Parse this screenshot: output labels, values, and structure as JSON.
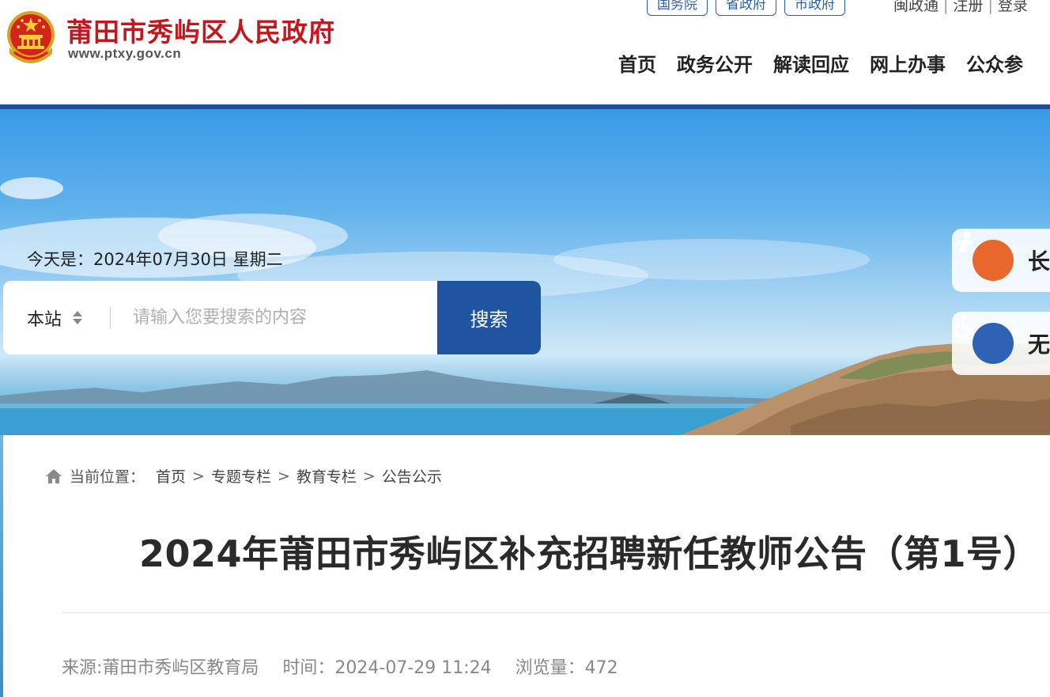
{
  "header": {
    "site_title": "莆田市秀屿区人民政府",
    "site_domain": "www.ptxy.gov.cn",
    "external_links": [
      "国务院",
      "省政府",
      "市政府"
    ],
    "user_links": [
      "闽政通",
      "注册",
      "登录"
    ],
    "nav": [
      "首页",
      "政务公开",
      "解读回应",
      "网上办事",
      "公众参"
    ]
  },
  "banner": {
    "date_prefix": "今天是：",
    "date": "2024年07月30日",
    "weekday": "星期二",
    "search": {
      "scope": "本站",
      "placeholder": "请输入您要搜索的内容",
      "button_label": "搜索"
    },
    "side_tabs": [
      {
        "label": "长",
        "icon": "elder-care-icon",
        "color": "#e8672c"
      },
      {
        "label": "无",
        "icon": "accessibility-icon",
        "color": "#2e62b5"
      }
    ]
  },
  "breadcrumb": {
    "prefix": "当前位置：",
    "items": [
      "首页",
      "专题专栏",
      "教育专栏",
      "公告公示"
    ],
    "separator": ">"
  },
  "article": {
    "title": "2024年莆田市秀屿区补充招聘新任教师公告（第1号）",
    "source": "来源:莆田市秀屿区教育局",
    "time": "时间：2024-07-29 11:24",
    "views": "浏览量：472"
  },
  "colors": {
    "title_red": "#c4161c",
    "primary_blue": "#1f55a0",
    "header_bar": "#1c4f96"
  }
}
